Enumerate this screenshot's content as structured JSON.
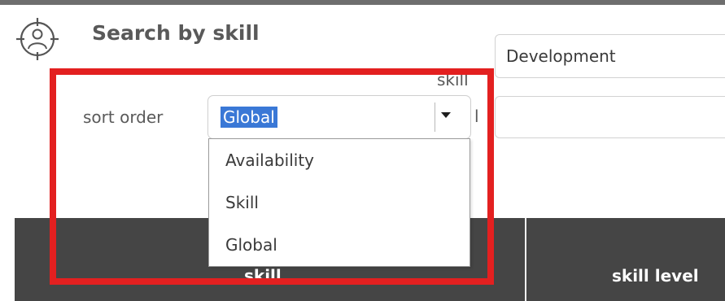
{
  "header": {
    "title": "Search by skill",
    "icon": "user-target-icon"
  },
  "form": {
    "skill_label": "skill",
    "skill_value": "Development",
    "level_label": "l",
    "level_value": "",
    "sort_label": "sort order",
    "sort_selected": "Global"
  },
  "dropdown": {
    "options": [
      "Availability",
      "Skill",
      "Global"
    ]
  },
  "table": {
    "columns": [
      "skill",
      "skill level"
    ]
  },
  "colors": {
    "highlight": "#e32020",
    "selection": "#3a78d6",
    "table_header": "#454545"
  }
}
